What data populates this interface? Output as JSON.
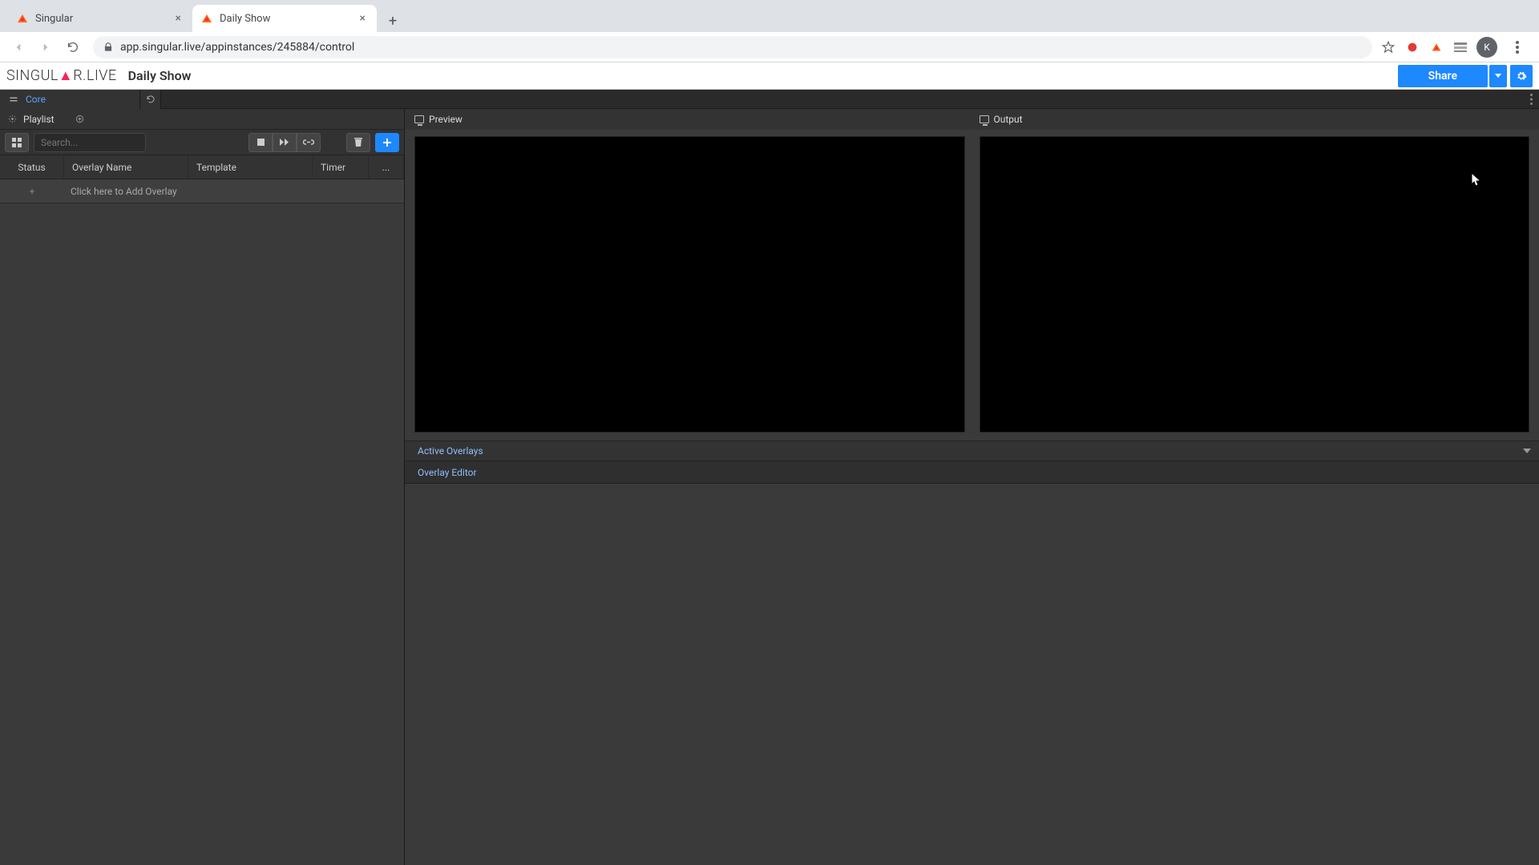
{
  "browser": {
    "tabs": [
      {
        "title": "Singular",
        "active": false
      },
      {
        "title": "Daily Show",
        "active": true
      }
    ],
    "url": "app.singular.live/appinstances/245884/control",
    "avatar_initial": "K"
  },
  "header": {
    "brand": "SINGULAR.LIVE",
    "project": "Daily Show",
    "share": "Share"
  },
  "subheader": {
    "core": "Core"
  },
  "playlist": {
    "title": "Playlist",
    "search_placeholder": "Search...",
    "columns": {
      "status": "Status",
      "name": "Overlay Name",
      "template": "Template",
      "timer": "Timer",
      "more": "..."
    },
    "add_row": "Click here to Add Overlay"
  },
  "panes": {
    "preview": "Preview",
    "output": "Output",
    "active_overlays": "Active Overlays",
    "overlay_editor": "Overlay Editor"
  }
}
